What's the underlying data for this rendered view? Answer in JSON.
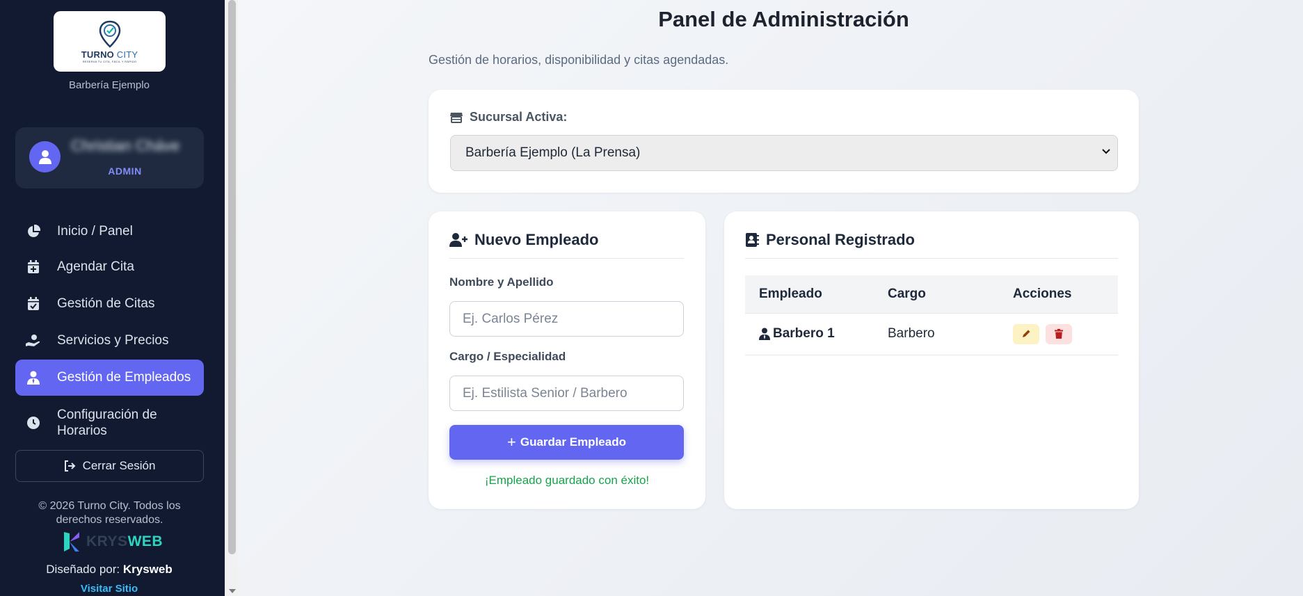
{
  "sidebar": {
    "logo": {
      "brand_bold": "TURNO",
      "brand_light": "CITY",
      "tagline": "RESERVA TU CITA, FÁCIL Y RÁPIDO"
    },
    "business_name": "Barbería Ejemplo",
    "user": {
      "name": "Christian Chávez",
      "role": "ADMIN"
    },
    "nav": [
      {
        "label": "Inicio / Panel",
        "icon": "pie-chart-icon"
      },
      {
        "label": "Agendar Cita",
        "icon": "calendar-plus-icon"
      },
      {
        "label": "Gestión de Citas",
        "icon": "calendar-check-icon"
      },
      {
        "label": "Servicios y Precios",
        "icon": "hand-holding-icon"
      },
      {
        "label": "Gestión de Empleados",
        "icon": "user-tie-icon",
        "active": true
      },
      {
        "label": "Configuración de Horarios",
        "icon": "clock-icon"
      }
    ],
    "logout_label": "Cerrar Sesión",
    "copyright": "© 2026 Turno City. Todos los derechos reservados.",
    "krys_logo": {
      "part1": "KRYS",
      "part2": "WEB"
    },
    "designed_prefix": "Diseñado por:",
    "designed_by": "Krysweb",
    "visit_label": "Visitar Sitio"
  },
  "main": {
    "title": "Panel de Administración",
    "subtitle": "Gestión de horarios, disponibilidad y citas agendadas.",
    "branch": {
      "label": "Sucursal Activa:",
      "selected": "Barbería Ejemplo (La Prensa)"
    },
    "new_employee": {
      "title": "Nuevo Empleado",
      "name_label": "Nombre y Apellido",
      "name_placeholder": "Ej. Carlos Pérez",
      "role_label": "Cargo / Especialidad",
      "role_placeholder": "Ej. Estilista Senior / Barbero",
      "save_label": "Guardar Empleado",
      "success_message": "¡Empleado guardado con éxito!"
    },
    "staff": {
      "title": "Personal Registrado",
      "columns": [
        "Empleado",
        "Cargo",
        "Acciones"
      ],
      "rows": [
        {
          "employee": "Barbero 1",
          "role": "Barbero"
        }
      ]
    }
  },
  "colors": {
    "sidebar_bg": "#111a30",
    "accent": "#6366f1",
    "success": "#16a34a",
    "edit_bg": "#fdf2c4",
    "delete_bg": "#fde0e0"
  }
}
